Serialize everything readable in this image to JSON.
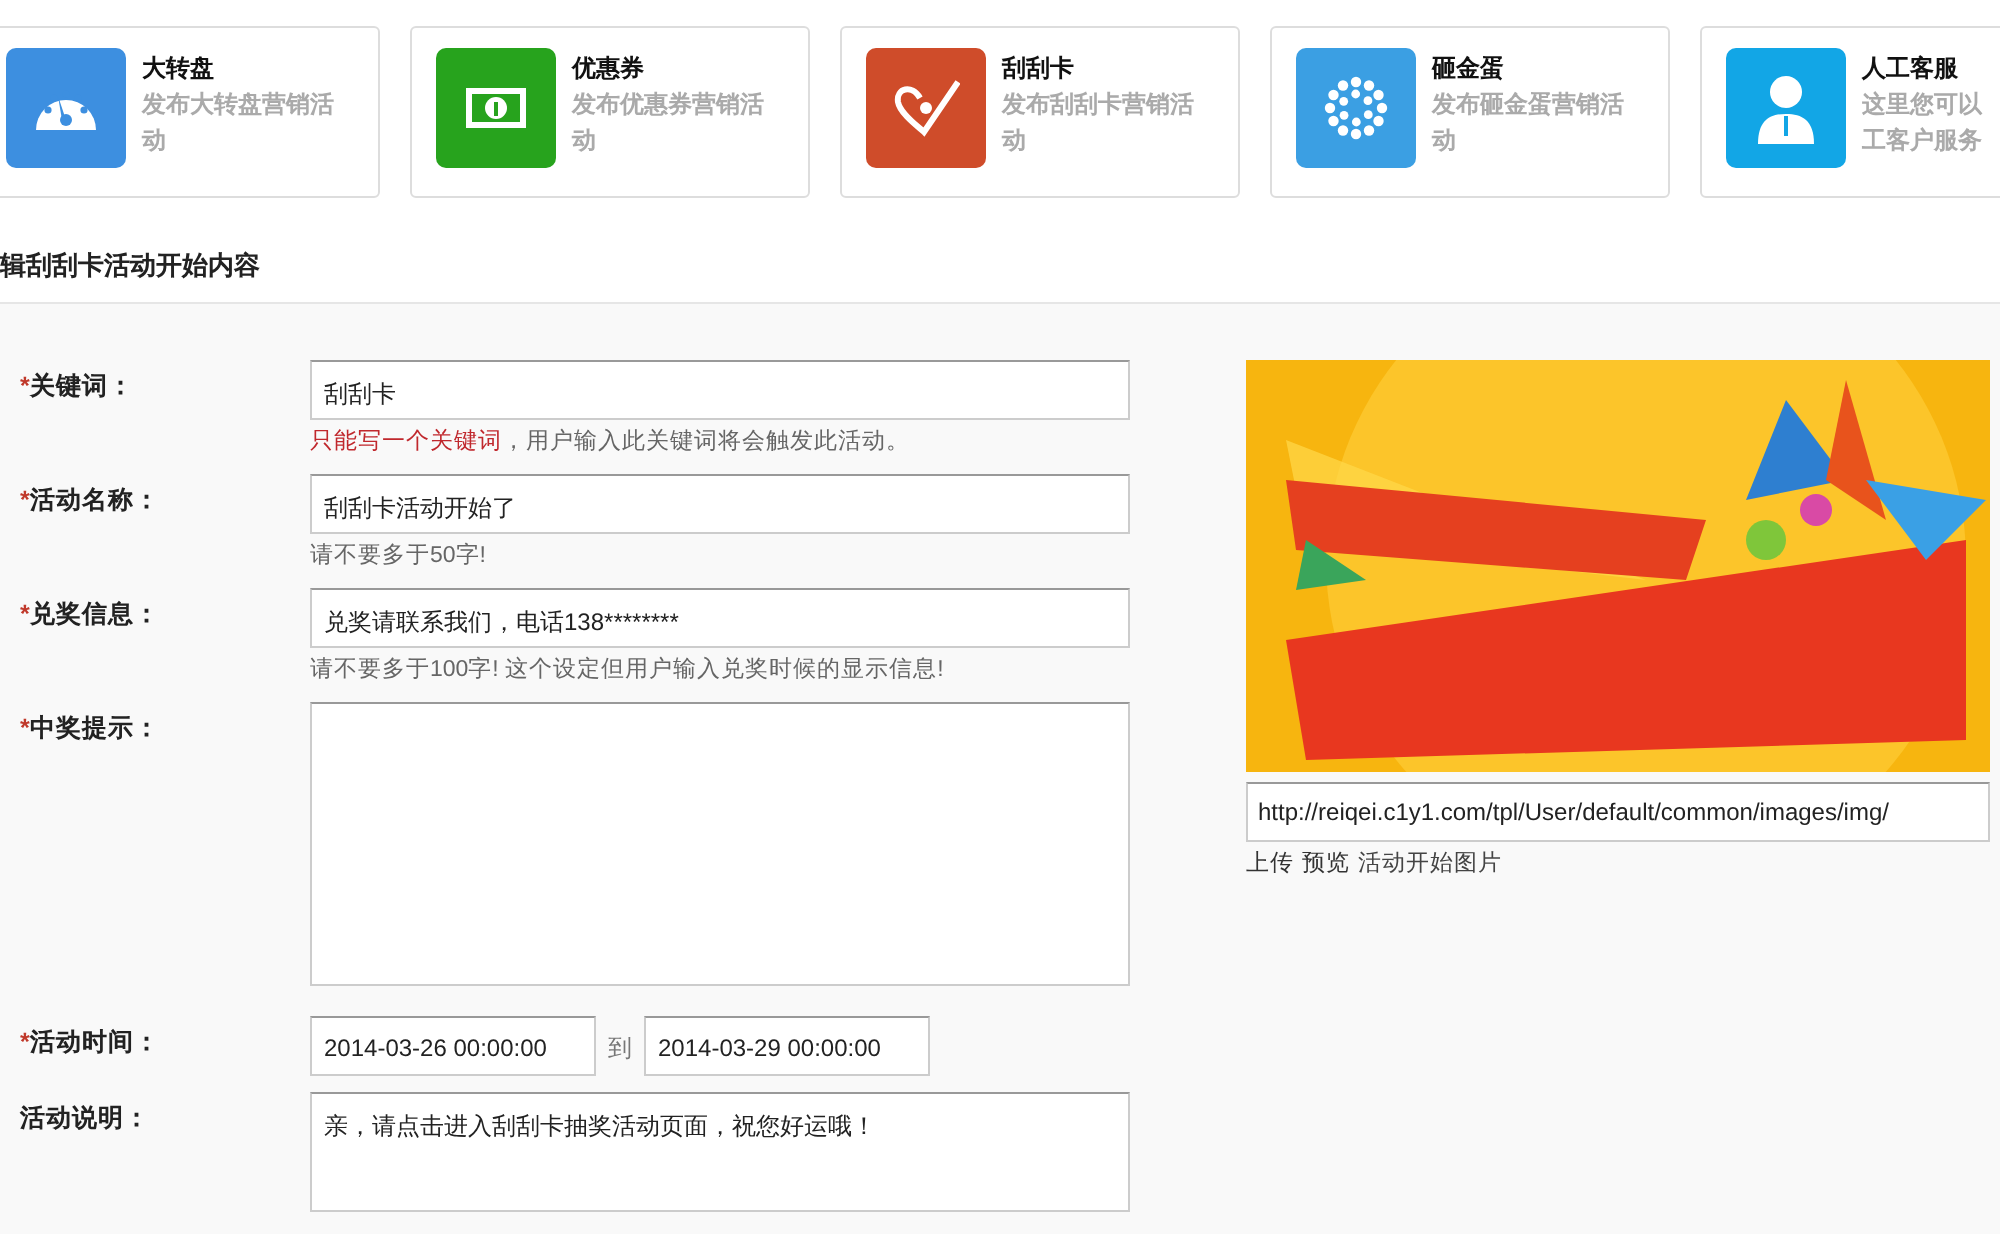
{
  "cards": [
    {
      "title": "大转盘",
      "desc": [
        "发布大转盘营销活",
        "动"
      ],
      "color": "#3d8fe0"
    },
    {
      "title": "优惠券",
      "desc": [
        "发布优惠券营销活",
        "动"
      ],
      "color": "#27a31d"
    },
    {
      "title": "刮刮卡",
      "desc": [
        "发布刮刮卡营销活",
        "动"
      ],
      "color": "#cf4c2a"
    },
    {
      "title": "砸金蛋",
      "desc": [
        "发布砸金蛋营销活",
        "动"
      ],
      "color": "#3b9fe3"
    },
    {
      "title": "人工客服",
      "desc": [
        "这里您可以",
        "工客户服务"
      ],
      "color": "#12a6e6"
    }
  ],
  "heading": "辑刮刮卡活动开始内容",
  "fields": [
    {
      "kind": "text",
      "mark": "*",
      "label": "关键词：",
      "value": "刮刮卡",
      "warning": "只能写一个关键词",
      "hint": "，用户输入此关键词将会触发此活动。"
    },
    {
      "kind": "text",
      "mark": "*",
      "label": "活动名称：",
      "value": "刮刮卡活动开始了",
      "hint": "请不要多于50字!"
    },
    {
      "kind": "text",
      "mark": "*",
      "label": "兑奖信息：",
      "value": "兑奖请联系我们，电话138********",
      "hint": "请不要多于100字! 这个设定但用户输入兑奖时候的显示信息!"
    },
    {
      "kind": "textarea",
      "mark": "*",
      "label": "中奖提示："
    },
    {
      "kind": "range",
      "mark": "*",
      "label": "活动时间：",
      "start": "2014-03-26 00:00:00",
      "separator": "到",
      "end": "2014-03-29 00:00:00"
    },
    {
      "kind": "note",
      "label": "活动说明：",
      "value": "亲，请点击进入刮刮卡抽奖活动页面，祝您好运哦！"
    }
  ],
  "image": {
    "url": "http://reiqei.c1y1.com/tpl/User/default/common/images/img/",
    "links": [
      "上传",
      "预览"
    ],
    "caption": "活动开始图片"
  }
}
